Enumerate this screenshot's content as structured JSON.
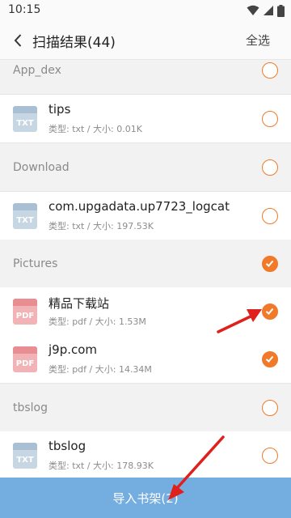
{
  "status_bar": {
    "time": "10:15"
  },
  "header": {
    "title": "扫描结果(44)",
    "select_all_label": "全选"
  },
  "sections": [
    {
      "label": "App_dex",
      "checked": false
    },
    {
      "label": "Download",
      "checked": false
    },
    {
      "label": "Pictures",
      "checked": true
    },
    {
      "label": "tbslog",
      "checked": false
    }
  ],
  "files": [
    {
      "name": "tips",
      "meta": "类型: txt / 大小: 0.01K",
      "icon_label": "TXT",
      "checked": false
    },
    {
      "name": "com.upgadata.up7723_logcat",
      "meta": "类型: txt / 大小: 197.53K",
      "icon_label": "TXT",
      "checked": false
    },
    {
      "name": "精品下载站",
      "meta": "类型: pdf / 大小: 1.53M",
      "icon_label": "PDF",
      "checked": true
    },
    {
      "name": "j9p.com",
      "meta": "类型: pdf / 大小: 14.34M",
      "icon_label": "PDF",
      "checked": true
    },
    {
      "name": "tbslog",
      "meta": "类型: txt / 大小: 178.93K",
      "icon_label": "TXT",
      "checked": false
    }
  ],
  "import_button": {
    "label": "导入书架(2)"
  },
  "colors": {
    "accent": "#f07a2a",
    "import_bar": "#74aee0",
    "annotation_arrow": "#e0201c"
  }
}
